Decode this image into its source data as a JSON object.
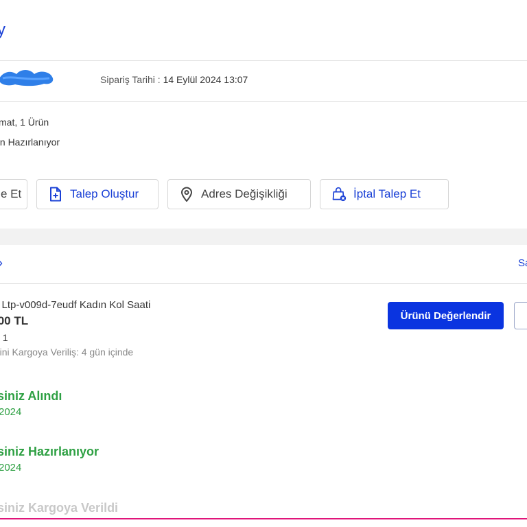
{
  "header": {
    "title": "y"
  },
  "order": {
    "date_label": "Sipariş Tarihi : ",
    "date_value": "14 Eylül 2024 13:07",
    "summary_line": "mat, 1 Ürün",
    "status_line": "ın Hazırlanıyor"
  },
  "actions": [
    {
      "label": "e Et",
      "icon": "partial-icon"
    },
    {
      "label": "Talep Oluştur",
      "icon": "document-plus-icon"
    },
    {
      "label": "Adres Değişikliği",
      "icon": "location-pin-icon"
    },
    {
      "label": "İptal Talep Et",
      "icon": "bag-cancel-icon"
    }
  ],
  "shipment": {
    "chevron": "›",
    "right_link": "Sa"
  },
  "product": {
    "name": "o Ltp-v009d-7eudf Kadın Kol Saati",
    "price": ",00 TL",
    "quantity": ": 1",
    "shipping": "mini Kargoya Veriliş: 4 gün içinde",
    "rate_button": "Ürünü Değerlendir"
  },
  "timeline": [
    {
      "title": "siniz Alındı",
      "date": "2024",
      "state": "done"
    },
    {
      "title": "siniz Hazırlanıyor",
      "date": "2024",
      "state": "done"
    },
    {
      "title": "siniz Kargoya Verildi",
      "date": "",
      "state": "pending"
    }
  ],
  "colors": {
    "accent": "#1a40d6",
    "primary_button": "#0a34e0",
    "success": "#2ea043",
    "pending": "#c8c8c8",
    "divider_pink": "#e0157a"
  }
}
